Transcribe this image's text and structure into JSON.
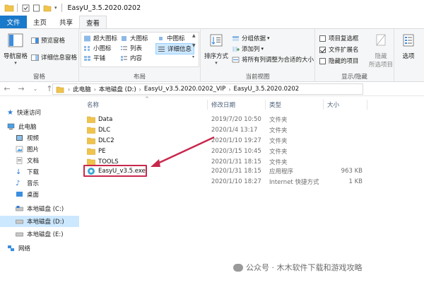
{
  "window": {
    "title": "EasyU_3.5.2020.0202"
  },
  "tabs": {
    "file": "文件",
    "home": "主页",
    "share": "共享",
    "view": "查看"
  },
  "ribbon": {
    "panes": {
      "label": "窗格",
      "nav_pane": "导航窗格",
      "preview_pane": "预览窗格",
      "details_pane": "详细信息窗格"
    },
    "layout": {
      "label": "布局",
      "xlarge_icons": "超大图标",
      "large_icons": "大图标",
      "medium_icons": "中图标",
      "small_icons": "小图标",
      "list": "列表",
      "details": "详细信息",
      "tiles": "平铺",
      "content": "内容"
    },
    "current_view": {
      "label": "当前视图",
      "sort_by": "排序方式",
      "group_by": "分组依据",
      "add_columns": "添加列",
      "size_all_columns": "将所有列调整为合适的大小"
    },
    "show_hide": {
      "label": "显示/隐藏",
      "item_checkboxes": "项目复选框",
      "file_extensions": "文件扩展名",
      "hidden_items": "隐藏的项目",
      "hide_selected": "隐藏",
      "hide_selected_line2": "所选项目",
      "options": "选项",
      "checked": {
        "item_checkboxes": false,
        "file_extensions": true,
        "hidden_items": false
      }
    }
  },
  "address": {
    "crumbs": [
      "此电脑",
      "本地磁盘 (D:)",
      "EasyU_v3.5.2020.0202_VIP",
      "EasyU_3.5.2020.0202"
    ]
  },
  "nav": {
    "items": [
      {
        "label": "快速访问",
        "icon": "star-icon"
      },
      {
        "label": "此电脑",
        "icon": "computer-icon"
      },
      {
        "label": "视频",
        "icon": "video-folder-icon"
      },
      {
        "label": "图片",
        "icon": "pictures-folder-icon"
      },
      {
        "label": "文档",
        "icon": "documents-folder-icon"
      },
      {
        "label": "下载",
        "icon": "download-folder-icon"
      },
      {
        "label": "音乐",
        "icon": "music-folder-icon"
      },
      {
        "label": "桌面",
        "icon": "desktop-folder-icon"
      },
      {
        "label": "本地磁盘 (C:)",
        "icon": "drive-icon"
      },
      {
        "label": "本地磁盘 (D:)",
        "icon": "drive-icon"
      },
      {
        "label": "本地磁盘 (E:)",
        "icon": "drive-icon"
      },
      {
        "label": "网络",
        "icon": "network-icon"
      }
    ]
  },
  "columns": {
    "name": "名称",
    "date": "修改日期",
    "type": "类型",
    "size": "大小"
  },
  "files": [
    {
      "name": "Data",
      "date": "2019/7/20 10:50",
      "type": "文件夹",
      "size": "",
      "icon": "folder-icon"
    },
    {
      "name": "DLC",
      "date": "2020/1/4 13:17",
      "type": "文件夹",
      "size": "",
      "icon": "folder-icon"
    },
    {
      "name": "DLC2",
      "date": "2020/1/10 19:27",
      "type": "文件夹",
      "size": "",
      "icon": "folder-icon"
    },
    {
      "name": "PE",
      "date": "2020/3/15 10:45",
      "type": "文件夹",
      "size": "",
      "icon": "folder-icon"
    },
    {
      "name": "TOOLS",
      "date": "2020/1/31 18:15",
      "type": "文件夹",
      "size": "",
      "icon": "folder-icon"
    },
    {
      "name": "EasyU_v3.5.exe",
      "date": "2020/1/31 18:15",
      "type": "应用程序",
      "size": "963 KB",
      "icon": "app-icon"
    },
    {
      "name": "",
      "date": "2020/1/10 18:27",
      "type": "Internet 快捷方式",
      "size": "1 KB",
      "icon": "internet-shortcut-icon"
    }
  ],
  "watermark": "公众号 · 木木软件下载和游戏攻略",
  "colors": {
    "file_tab": "#1979ca",
    "highlight_box": "#c8284d",
    "arrow": "#c8284d",
    "folder": "#f0c44c",
    "selection": "#cce8ff"
  }
}
